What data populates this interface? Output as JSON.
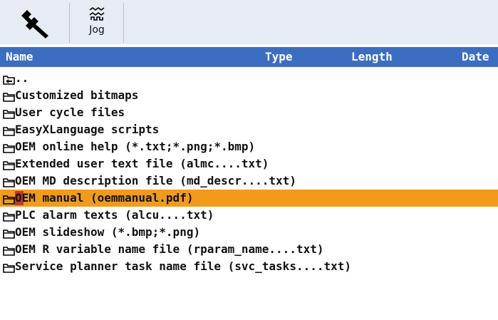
{
  "toolbar": {
    "wrench_icon": "wrench-icon",
    "jog_label": "Jog",
    "jog_icon": "jog-wave-icon"
  },
  "columns": {
    "name": "Name",
    "type": "Type",
    "length": "Length",
    "date": "Date"
  },
  "rows": [
    {
      "label": "..",
      "icon": "parent-folder-icon",
      "selected": false
    },
    {
      "label": "Customized bitmaps",
      "icon": "folder-icon",
      "selected": false
    },
    {
      "label": "User cycle files",
      "icon": "folder-icon",
      "selected": false
    },
    {
      "label": "EasyXLanguage scripts",
      "icon": "folder-icon",
      "selected": false
    },
    {
      "label": "OEM online help (*.txt;*.png;*.bmp)",
      "icon": "folder-icon",
      "selected": false
    },
    {
      "label": "Extended user text file (almc....txt)",
      "icon": "folder-icon",
      "selected": false
    },
    {
      "label": "OEM MD description file (md_descr....txt)",
      "icon": "folder-icon",
      "selected": false
    },
    {
      "label": "OEM manual (oemmanual.pdf)",
      "icon": "folder-icon",
      "selected": true
    },
    {
      "label": "PLC alarm texts (alcu....txt)",
      "icon": "folder-icon",
      "selected": false
    },
    {
      "label": "OEM slideshow (*.bmp;*.png)",
      "icon": "folder-icon",
      "selected": false
    },
    {
      "label": "OEM R variable name file (rparam_name....txt)",
      "icon": "folder-icon",
      "selected": false
    },
    {
      "label": "Service planner task name file (svc_tasks....txt)",
      "icon": "folder-icon",
      "selected": false
    }
  ],
  "colors": {
    "header_bg": "#3c6ec0",
    "selection_bg": "#f29a1c",
    "cursor": "#c0392b",
    "toolbar_bg": "#e6ebf4"
  }
}
